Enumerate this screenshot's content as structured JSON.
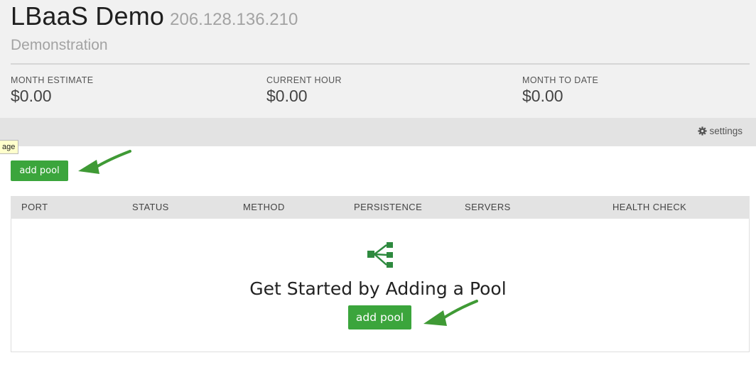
{
  "header": {
    "title": "LBaaS Demo",
    "ip": "206.128.136.210",
    "subtitle": "Demonstration"
  },
  "stats": [
    {
      "label": "MONTH ESTIMATE",
      "value": "$0.00"
    },
    {
      "label": "CURRENT HOUR",
      "value": "$0.00"
    },
    {
      "label": "MONTH TO DATE",
      "value": "$0.00"
    }
  ],
  "toolbar": {
    "settings_label": "settings",
    "settings_icon": "gear-icon"
  },
  "tooltip": {
    "text": "age"
  },
  "actions": {
    "add_pool_label": "add pool"
  },
  "table": {
    "columns": [
      "PORT",
      "STATUS",
      "METHOD",
      "PERSISTENCE",
      "SERVERS",
      "HEALTH CHECK"
    ]
  },
  "empty_state": {
    "icon": "pool-hierarchy-icon",
    "title": "Get Started by Adding a Pool",
    "button_label": "add pool"
  },
  "colors": {
    "accent_green": "#3ba53c",
    "icon_green": "#2e8a3f",
    "annotation_arrow": "#3f9a35"
  }
}
